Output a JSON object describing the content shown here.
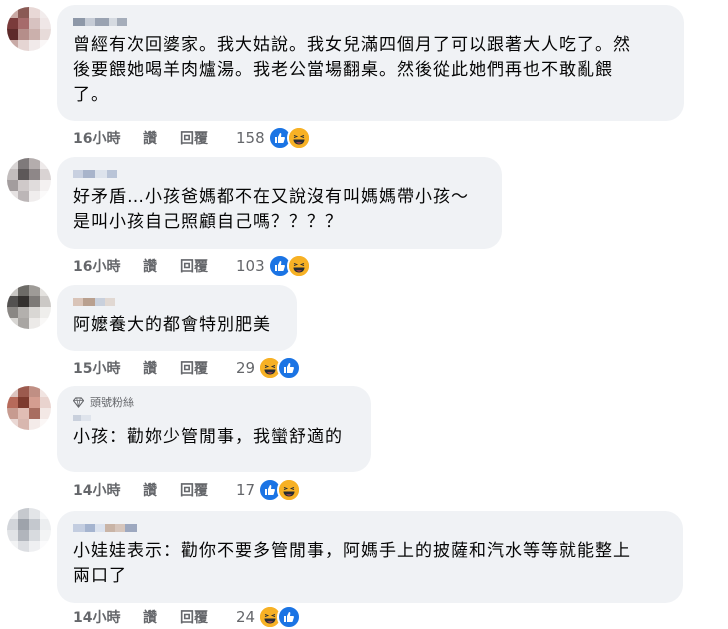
{
  "actions_labels": {
    "like": "讚",
    "reply": "回覆"
  },
  "comments": [
    {
      "badge": "",
      "text": "曾經有次回婆家。我大姑說。我女兒滿四個月了可以跟著大人吃了。然\n後要餵她喝羊肉爐湯。我老公當場翻桌。然後從此她們再也不敢亂餵\n了。",
      "time": "16小時",
      "count": "158",
      "reactions": [
        "like",
        "haha"
      ]
    },
    {
      "badge": "",
      "text": "好矛盾…小孩爸媽都不在又說沒有叫媽媽帶小孩～\n是叫小孩自己照顧自己嗎？？？？",
      "time": "16小時",
      "count": "103",
      "reactions": [
        "like",
        "haha"
      ]
    },
    {
      "badge": "",
      "text": "阿嬤養大的都會特別肥美",
      "time": "15小時",
      "count": "29",
      "reactions": [
        "haha",
        "like"
      ]
    },
    {
      "badge": "頭號粉絲",
      "text": "小孩：勸妳少管閒事，我蠻舒適的",
      "time": "14小時",
      "count": "17",
      "reactions": [
        "like",
        "haha"
      ]
    },
    {
      "badge": "",
      "text": "小娃娃表示：勸你不要多管閒事，阿媽手上的披薩和汽水等等就能整上\n兩口了",
      "time": "14小時",
      "count": "24",
      "reactions": [
        "haha",
        "like"
      ]
    }
  ]
}
